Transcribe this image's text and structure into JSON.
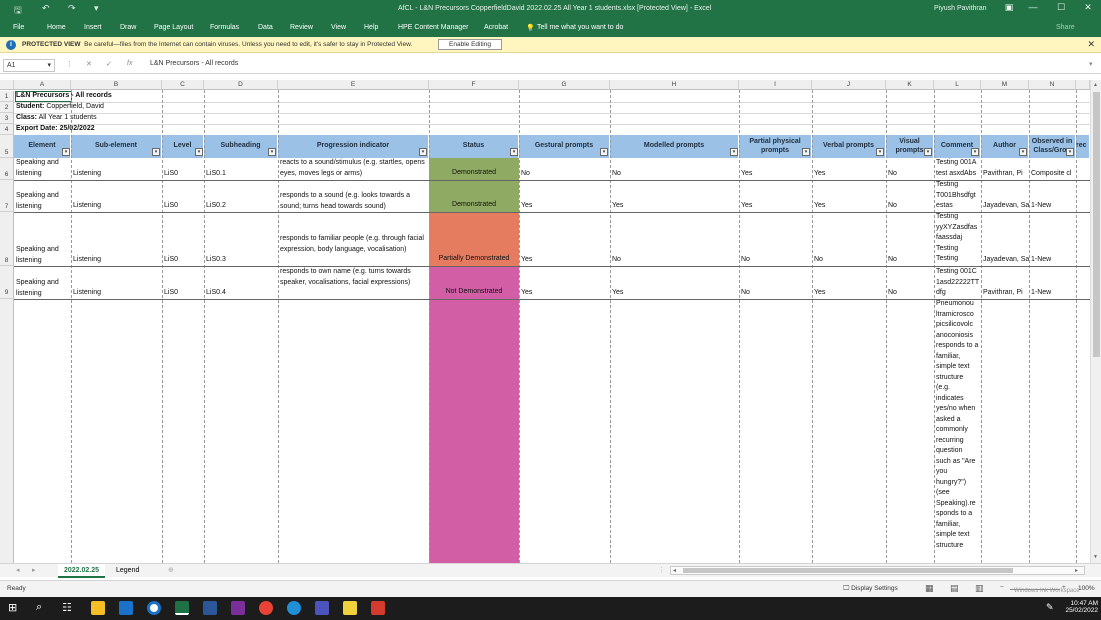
{
  "window": {
    "title": "AfCL - L&N Precursors CopperfieldDavid 2022.02.25 All Year 1 students.xlsx  [Protected View]  -  Excel",
    "user": "Piyush Pavithran",
    "share": "Share"
  },
  "ribbon": {
    "tabs": [
      "File",
      "Home",
      "Insert",
      "Draw",
      "Page Layout",
      "Formulas",
      "Data",
      "Review",
      "View",
      "Help",
      "HPE Content Manager",
      "Acrobat"
    ],
    "tell_me": "Tell me what you want to do"
  },
  "protected_view": {
    "label": "PROTECTED VIEW",
    "message": "Be careful—files from the Internet can contain viruses. Unless you need to edit, it's safer to stay in Protected View.",
    "button": "Enable Editing"
  },
  "formula_bar": {
    "name_box": "A1",
    "formula": "L&N Precursors - All records"
  },
  "columns": [
    "A",
    "B",
    "C",
    "D",
    "E",
    "F",
    "G",
    "H",
    "I",
    "J",
    "K",
    "L",
    "M",
    "N"
  ],
  "rows": [
    "1",
    "2",
    "3",
    "4",
    "5",
    "6",
    "7",
    "8",
    "9"
  ],
  "info_rows": {
    "r1": "L&N Precursors - All records",
    "r2_label": "Student:",
    "r2_value": "Copperfield, David",
    "r3_label": "Class:",
    "r3_value": "All Year 1 students",
    "r4_label": "Export Date:",
    "r4_value": "25/02/2022"
  },
  "headers": [
    "Element",
    "Sub-element",
    "Level",
    "Subheading",
    "Progression indicator",
    "Status",
    "Gestural prompts",
    "Modelled prompts",
    "Partial physical prompts",
    "Verbal prompts",
    "Visual prompts",
    "Comment",
    "Author",
    "Observed in Class/Grou",
    "rec"
  ],
  "data_rows": [
    {
      "element": "Speaking and listening",
      "sub": "Listening",
      "level": "LiS0",
      "subheading": "LiS0.1",
      "indicator": "reacts to a sound/stimulus (e.g. startles, opens eyes, moves legs or arms)",
      "status": "Demonstrated",
      "gestural": "No",
      "modelled": "No",
      "partial": "Yes",
      "verbal": "Yes",
      "visual": "No",
      "comment": "Testing 001A test asxdAbs",
      "author": "Pavithran, Pi",
      "observed": "Composite cl"
    },
    {
      "element": "Speaking and listening",
      "sub": "Listening",
      "level": "LiS0",
      "subheading": "LiS0.2",
      "indicator": "responds to a sound (e.g. looks towards a sound; turns head towards sound)",
      "status": "Demonstrated",
      "gestural": "Yes",
      "modelled": "Yes",
      "partial": "Yes",
      "verbal": "Yes",
      "visual": "No",
      "comment": "Testing T001Bhsdfgt estas",
      "author": "Jayadevan, Sa",
      "observed": "1-New"
    },
    {
      "element": "Speaking and listening",
      "sub": "Listening",
      "level": "LiS0",
      "subheading": "LiS0.3",
      "indicator": "responds to familiar people (e.g. through facial expression, body language, vocalisation)",
      "status": "Partially Demonstrated",
      "gestural": "Yes",
      "modelled": "No",
      "partial": "No",
      "verbal": "No",
      "visual": "No",
      "comment": "Testing yyXYZasdfas faassdaj Testing Testing",
      "author": "Jayadevan, Sa",
      "observed": "1-New"
    },
    {
      "element": "Speaking and listening",
      "sub": "Listening",
      "level": "LiS0",
      "subheading": "LiS0.4",
      "indicator": "responds to own name (e.g. turns towards speaker, vocalisations, facial expressions)",
      "status": "Not Demonstrated",
      "gestural": "Yes",
      "modelled": "Yes",
      "partial": "No",
      "verbal": "Yes",
      "visual": "No",
      "comment": "Testing 001C 1asd22222TT dfg",
      "author": "Pavithran, Pi",
      "observed": "1-New"
    }
  ],
  "overflow_comment": "Pneumonou ltramicrosco picsilicovolc anoconiosis responds to a familiar, simple text structure (e.g. indicates yes/no when asked a commonly recurring question such as \"Are you hungry?\") (see Speaking).re sponds to a familiar, simple text structure",
  "status_colors": {
    "Demonstrated": "#8faa63",
    "Partially Demonstrated": "#e57c5f",
    "Not Demonstrated": "#d25ea6"
  },
  "sheet_tabs": [
    "2022.02.25",
    "Legend"
  ],
  "status_bar": {
    "ready": "Ready",
    "display_settings": "Display Settings",
    "zoom": "100%",
    "watermark": "Windows Ink Workspace"
  },
  "taskbar": {
    "time": "10:47 AM",
    "date": "25/02/2022"
  }
}
